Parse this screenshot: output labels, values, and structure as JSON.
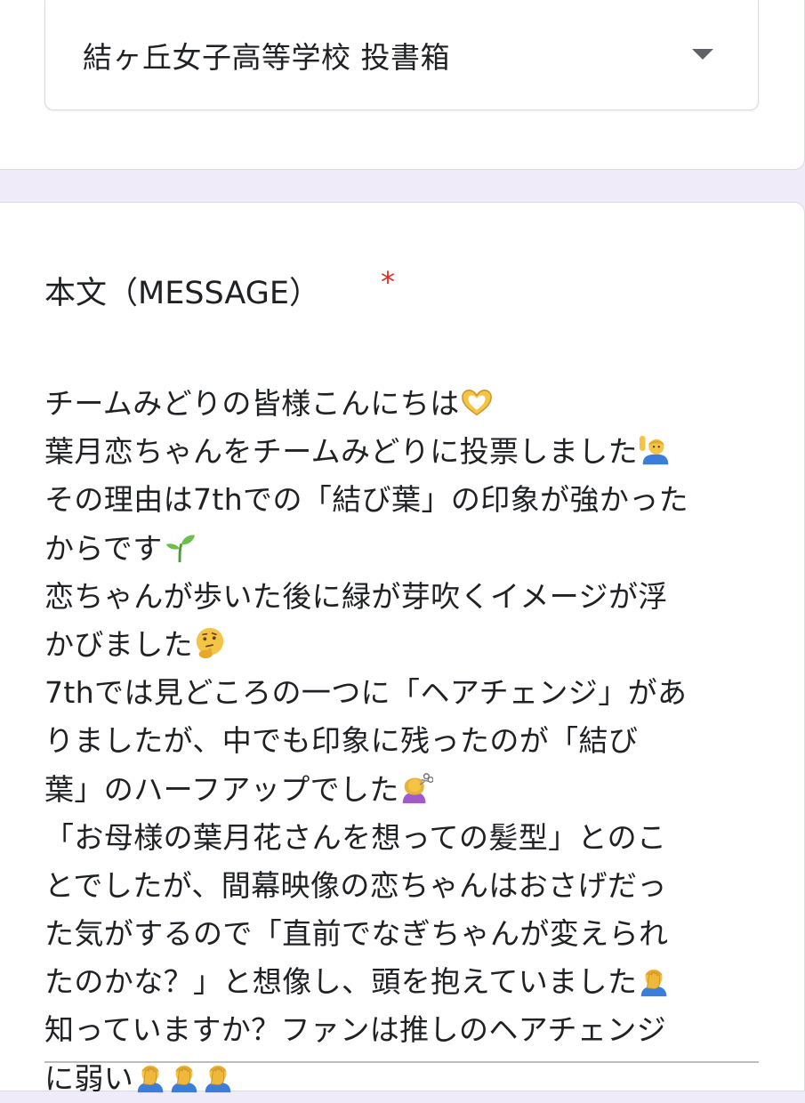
{
  "dropdown": {
    "selected": "結ヶ丘女子高等学校 投書箱",
    "icon": "dropdown-arrow-icon"
  },
  "question": {
    "title": "本文（MESSAGE）",
    "required_mark": "*"
  },
  "answer_lines": [
    {
      "text": "チームみどりの皆様こんにちは",
      "emoji": [
        "heart-hands-icon"
      ]
    },
    {
      "text": "葉月恋ちゃんをチームみどりに投票しました",
      "emoji": [
        "person-raising-hand-icon"
      ]
    },
    {
      "text": "その理由は7thでの「結び葉」の印象が強かった",
      "emoji": []
    },
    {
      "text": "からです",
      "emoji": [
        "seedling-icon"
      ]
    },
    {
      "text": "恋ちゃんが歩いた後に緑が芽吹くイメージが浮",
      "emoji": []
    },
    {
      "text": "かびました",
      "emoji": [
        "thinking-face-icon"
      ]
    },
    {
      "text": "7thでは見どころの一つに「ヘアチェンジ」があ",
      "emoji": []
    },
    {
      "text": "りましたが、中でも印象に残ったのが「結び",
      "emoji": []
    },
    {
      "text": "葉」のハーフアップでした",
      "emoji": [
        "haircut-icon"
      ]
    },
    {
      "text": "「お母様の葉月花さんを想っての髪型」とのこ",
      "emoji": []
    },
    {
      "text": "とでしたが、間幕映像の恋ちゃんはおさげだっ",
      "emoji": []
    },
    {
      "text": "た気がするので「直前でなぎちゃんが変えられ",
      "emoji": []
    },
    {
      "text": "たのかな？」と想像し、頭を抱えていました",
      "emoji": [
        "facepalm-icon"
      ]
    },
    {
      "text": "知っていますか？ファンは推しのヘアチェンジ",
      "emoji": []
    },
    {
      "text": "に弱い",
      "emoji": [
        "facepalm-icon",
        "facepalm-icon",
        "facepalm-icon"
      ]
    }
  ],
  "colors": {
    "background": "#f0ebf8",
    "required": "#d93025",
    "text": "#202124"
  }
}
